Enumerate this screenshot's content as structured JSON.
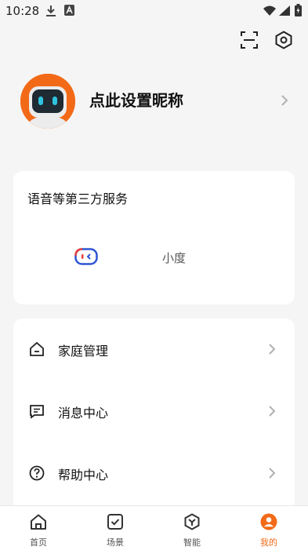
{
  "status_bar": {
    "time": "10:28"
  },
  "header": {
    "scan_icon": "scan-icon",
    "settings_icon": "settings-hexagon-icon"
  },
  "profile": {
    "nickname": "点此设置昵称",
    "avatar_color": "#f26a18"
  },
  "services": {
    "title": "语音等第三方服务",
    "items": [
      {
        "label": "小度",
        "icon": "xiaodu-icon"
      }
    ]
  },
  "menu": {
    "items": [
      {
        "label": "家庭管理",
        "icon": "home-icon"
      },
      {
        "label": "消息中心",
        "icon": "message-icon"
      },
      {
        "label": "帮助中心",
        "icon": "help-icon"
      }
    ]
  },
  "tabbar": {
    "active_color": "#f26a18",
    "tabs": [
      {
        "label": "首页",
        "icon": "home-tab-icon"
      },
      {
        "label": "场景",
        "icon": "scene-tab-icon"
      },
      {
        "label": "智能",
        "icon": "smart-tab-icon"
      },
      {
        "label": "我的",
        "icon": "profile-tab-icon",
        "active": true
      }
    ]
  }
}
